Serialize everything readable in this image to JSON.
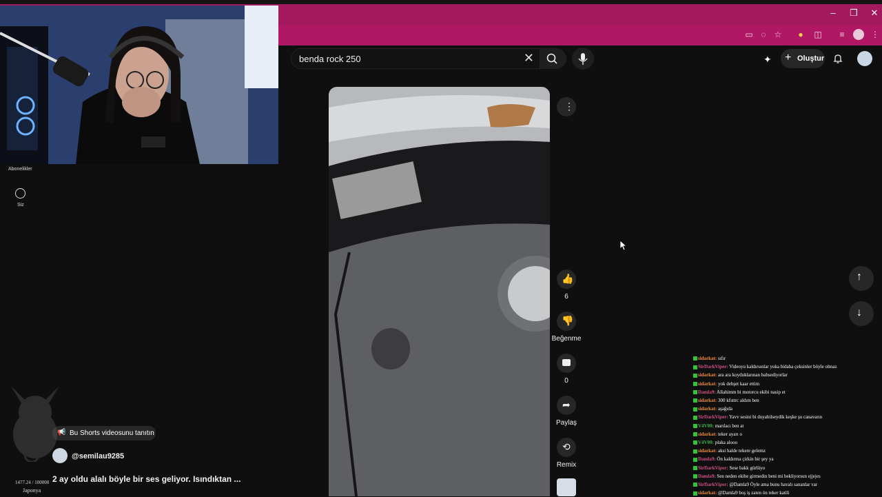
{
  "browser": {
    "window_controls": [
      "–",
      "❐",
      "✕"
    ]
  },
  "youtube": {
    "search": {
      "query": "benda rock 250"
    },
    "create_label": "Oluştur",
    "sidebar": {
      "subscriptions_label": "Abonelikler",
      "you_label": "Siz"
    }
  },
  "short": {
    "like_count": "6",
    "dislike_label": "Beğenme",
    "comment_count": "0",
    "share_label": "Paylaş",
    "remix_label": "Remix",
    "promo_label": "Bu Shorts videosunu tanıtın",
    "channel_handle": "@semilau9285",
    "caption": "2 ay oldu alalı böyle bir ses geliyor. Isındıktan ..."
  },
  "overlay": {
    "stats_line": "1477.24 / 100000",
    "country": "Japonya"
  },
  "chat": [
    {
      "name": "sidarkat",
      "color": "#f28c38",
      "text": "sıfır",
      "icons": "K"
    },
    {
      "name": "SirDarkViper",
      "color": "#d24f86",
      "text": "Videoyu kaldırsınlar yuka bidaha çeksinler böyle olmaz",
      "icons": "K"
    },
    {
      "name": "sidarkat",
      "color": "#f28c38",
      "text": "ara ara koyduklarınan bahsediyorlar",
      "icons": "K"
    },
    {
      "name": "sidarkat",
      "color": "#f28c38",
      "text": "yok dehşet kaar ettim",
      "icons": "K"
    },
    {
      "name": "Damla9",
      "color": "#d24f86",
      "text": "Allahimm bi motorcu ekibi nasip et",
      "icons": "K✓"
    },
    {
      "name": "sidarkat",
      "color": "#f28c38",
      "text": "300 kfsttrc aldım ben",
      "icons": "K"
    },
    {
      "name": "sidarkat",
      "color": "#f28c38",
      "text": "aşağıda",
      "icons": "K"
    },
    {
      "name": "SirDarkViper",
      "color": "#d24f86",
      "text": "Yavv sesini bi duyabilseydik keşke şu canavarın",
      "icons": "K"
    },
    {
      "name": "V4V00",
      "color": "#3ab54a",
      "text": "marılacı ben at",
      "icons": "K"
    },
    {
      "name": "sidarkat",
      "color": "#f28c38",
      "text": "teker ayarı o",
      "icons": "K"
    },
    {
      "name": "V4V00",
      "color": "#3ab54a",
      "text": "plaka alooo",
      "icons": "K"
    },
    {
      "name": "sidarkat",
      "color": "#f28c38",
      "text": "aksi halde tekere gelemz",
      "icons": "K"
    },
    {
      "name": "Damla9",
      "color": "#d24f86",
      "text": "Ön kaldırma çirkin bir şey ya",
      "icons": "K✓"
    },
    {
      "name": "SirDarkViper",
      "color": "#d24f86",
      "text": "Sese bakk gürlüyo",
      "icons": "K"
    },
    {
      "name": "Damla9",
      "color": "#d24f86",
      "text": "Sen neden ekibe girmedin beni mi bekliyorsun ejjejes",
      "icons": "K✓"
    },
    {
      "name": "SirDarkViper",
      "color": "#d24f86",
      "text": "@Damla9 Öyle ama bunu havalı sananlar var",
      "icons": "K"
    },
    {
      "name": "sidarkat",
      "color": "#f28c38",
      "text": "@Damla9 boş iş zaten ön teker katili",
      "icons": "K"
    }
  ]
}
